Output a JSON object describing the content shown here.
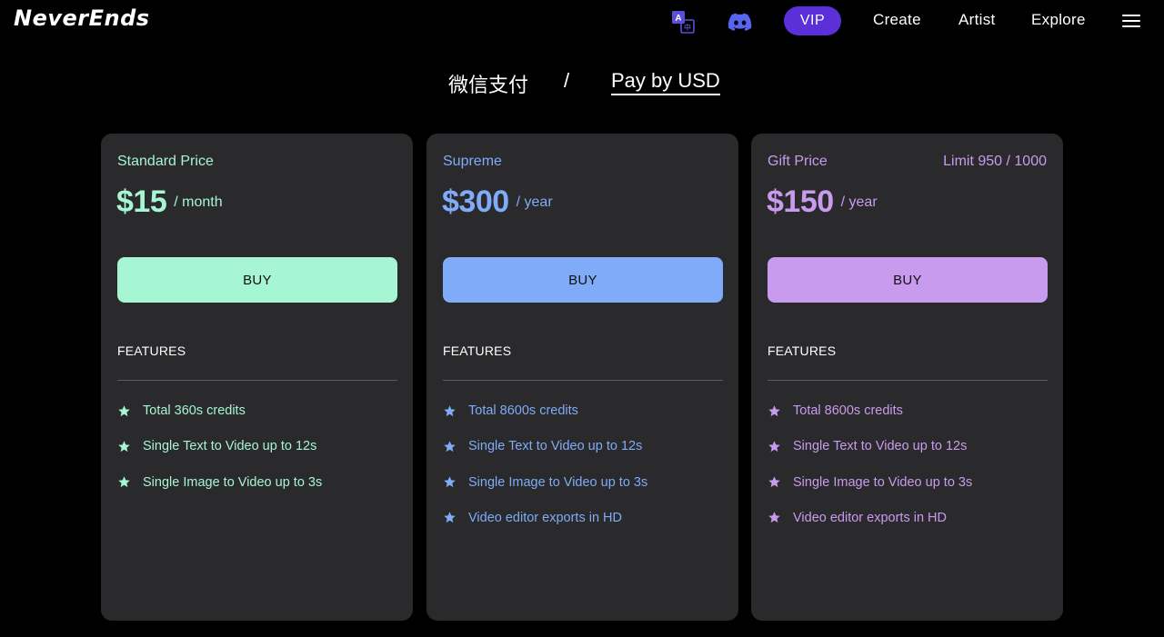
{
  "header": {
    "logo": "NeverEnds",
    "vip_label": "VIP",
    "nav": {
      "create": "Create",
      "artist": "Artist",
      "explore": "Explore"
    }
  },
  "payment": {
    "wechat_label": "微信支付",
    "separator": "/",
    "usd_label": "Pay by USD"
  },
  "colors": {
    "green": "#a6f5d3",
    "blue": "#7fabf8",
    "purple": "#c99bef",
    "vip": "#5b30d9",
    "card_bg": "#2a292b"
  },
  "plans": [
    {
      "title": "Standard Price",
      "price": "$15",
      "period": "/ month",
      "buy_label": "BUY",
      "features_label": "FEATURES",
      "features": [
        "Total 360s credits",
        "Single Text to Video up to 12s",
        "Single Image to Video up to 3s"
      ]
    },
    {
      "title": "Supreme",
      "price": "$300",
      "period": "/ year",
      "buy_label": "BUY",
      "features_label": "FEATURES",
      "features": [
        "Total 8600s credits",
        "Single Text to Video up to 12s",
        "Single Image to Video up to 3s",
        "Video editor exports in HD"
      ]
    },
    {
      "title": "Gift Price",
      "limit": "Limit 950 / 1000",
      "price": "$150",
      "period": "/ year",
      "buy_label": "BUY",
      "features_label": "FEATURES",
      "features": [
        "Total 8600s credits",
        "Single Text to Video up to 12s",
        "Single Image to Video up to 3s",
        "Video editor exports in HD"
      ]
    }
  ]
}
